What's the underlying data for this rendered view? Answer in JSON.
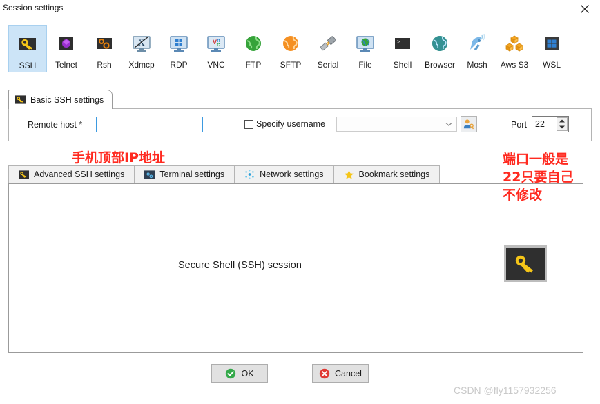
{
  "window": {
    "title": "Session settings",
    "close_label": "×"
  },
  "protocols": [
    {
      "label": "SSH",
      "icon": "key-icon",
      "selected": true
    },
    {
      "label": "Telnet",
      "icon": "telnet-icon",
      "selected": false
    },
    {
      "label": "Rsh",
      "icon": "rsh-icon",
      "selected": false
    },
    {
      "label": "Xdmcp",
      "icon": "xdmcp-icon",
      "selected": false
    },
    {
      "label": "RDP",
      "icon": "rdp-icon",
      "selected": false
    },
    {
      "label": "VNC",
      "icon": "vnc-icon",
      "selected": false
    },
    {
      "label": "FTP",
      "icon": "ftp-globe-icon",
      "selected": false
    },
    {
      "label": "SFTP",
      "icon": "sftp-globe-icon",
      "selected": false
    },
    {
      "label": "Serial",
      "icon": "serial-plug-icon",
      "selected": false
    },
    {
      "label": "File",
      "icon": "file-icon",
      "selected": false
    },
    {
      "label": "Shell",
      "icon": "shell-icon",
      "selected": false
    },
    {
      "label": "Browser",
      "icon": "browser-icon",
      "selected": false
    },
    {
      "label": "Mosh",
      "icon": "mosh-dish-icon",
      "selected": false
    },
    {
      "label": "Aws S3",
      "icon": "aws-s3-icon",
      "selected": false
    },
    {
      "label": "WSL",
      "icon": "wsl-icon",
      "selected": false
    }
  ],
  "basic_tab": {
    "label": "Basic SSH settings",
    "icon": "key-icon"
  },
  "basic_form": {
    "remote_host_label": "Remote host *",
    "remote_host_value": "",
    "remote_host_placeholder": "",
    "specify_username_label": "Specify username",
    "specify_username_checked": false,
    "username_value": "",
    "username_placeholder": "",
    "user_key_icon": "user-key-icon",
    "port_label": "Port",
    "port_value": "22"
  },
  "subtabs": [
    {
      "label": "Advanced SSH settings",
      "icon": "key-icon",
      "active": true
    },
    {
      "label": "Terminal settings",
      "icon": "terminal-icon",
      "active": false
    },
    {
      "label": "Network settings",
      "icon": "network-icon",
      "active": false
    },
    {
      "label": "Bookmark settings",
      "icon": "star-icon",
      "active": false
    }
  ],
  "content": {
    "description": "Secure Shell (SSH) session",
    "big_icon": "key-icon"
  },
  "buttons": {
    "ok_label": "OK",
    "ok_icon": "check-circle-icon",
    "cancel_label": "Cancel",
    "cancel_icon": "x-circle-icon"
  },
  "annotations": {
    "host_note": "手机顶部IP地址",
    "port_note": "端口一般是\n22只要自己\n不修改",
    "annotation_color": "#ff2a20"
  },
  "watermark": "CSDN @fly1157932256"
}
